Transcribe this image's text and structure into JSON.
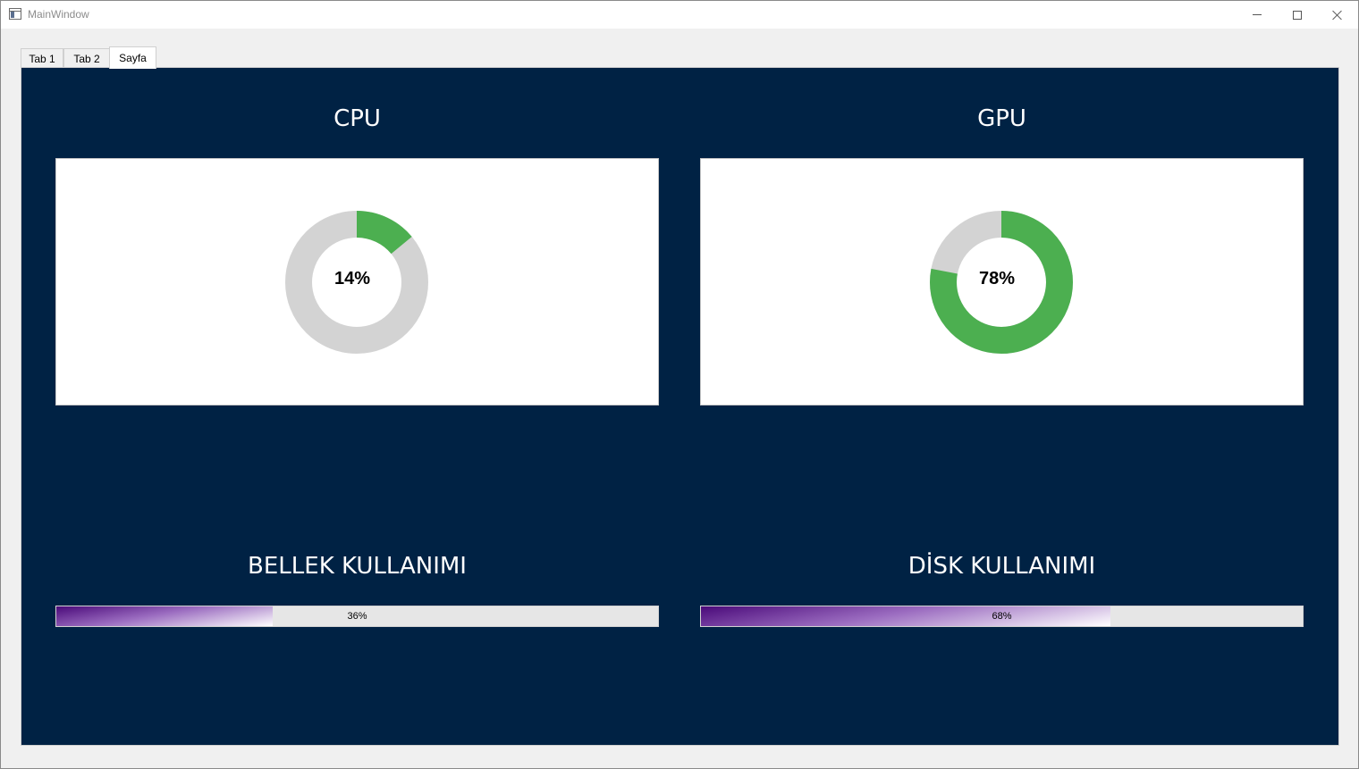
{
  "window": {
    "title": "MainWindow"
  },
  "tabs": [
    {
      "label": "Tab 1",
      "active": false
    },
    {
      "label": "Tab 2",
      "active": false
    },
    {
      "label": "Sayfa",
      "active": true
    }
  ],
  "cpu": {
    "title": "CPU",
    "value": 14,
    "label": "14%"
  },
  "gpu": {
    "title": "GPU",
    "value": 78,
    "label": "78%"
  },
  "memory": {
    "title": "BELLEK KULLANIMI",
    "value": 36,
    "label": "36%"
  },
  "disk": {
    "title": "DİSK KULLANIMI",
    "value": 68,
    "label": "68%"
  },
  "colors": {
    "panel_bg": "#002244",
    "donut_fill": "#4caf50",
    "donut_track": "#d3d3d3",
    "bar_track": "#e6e6e6",
    "bar_fill_start": "#4a0a7a"
  }
}
